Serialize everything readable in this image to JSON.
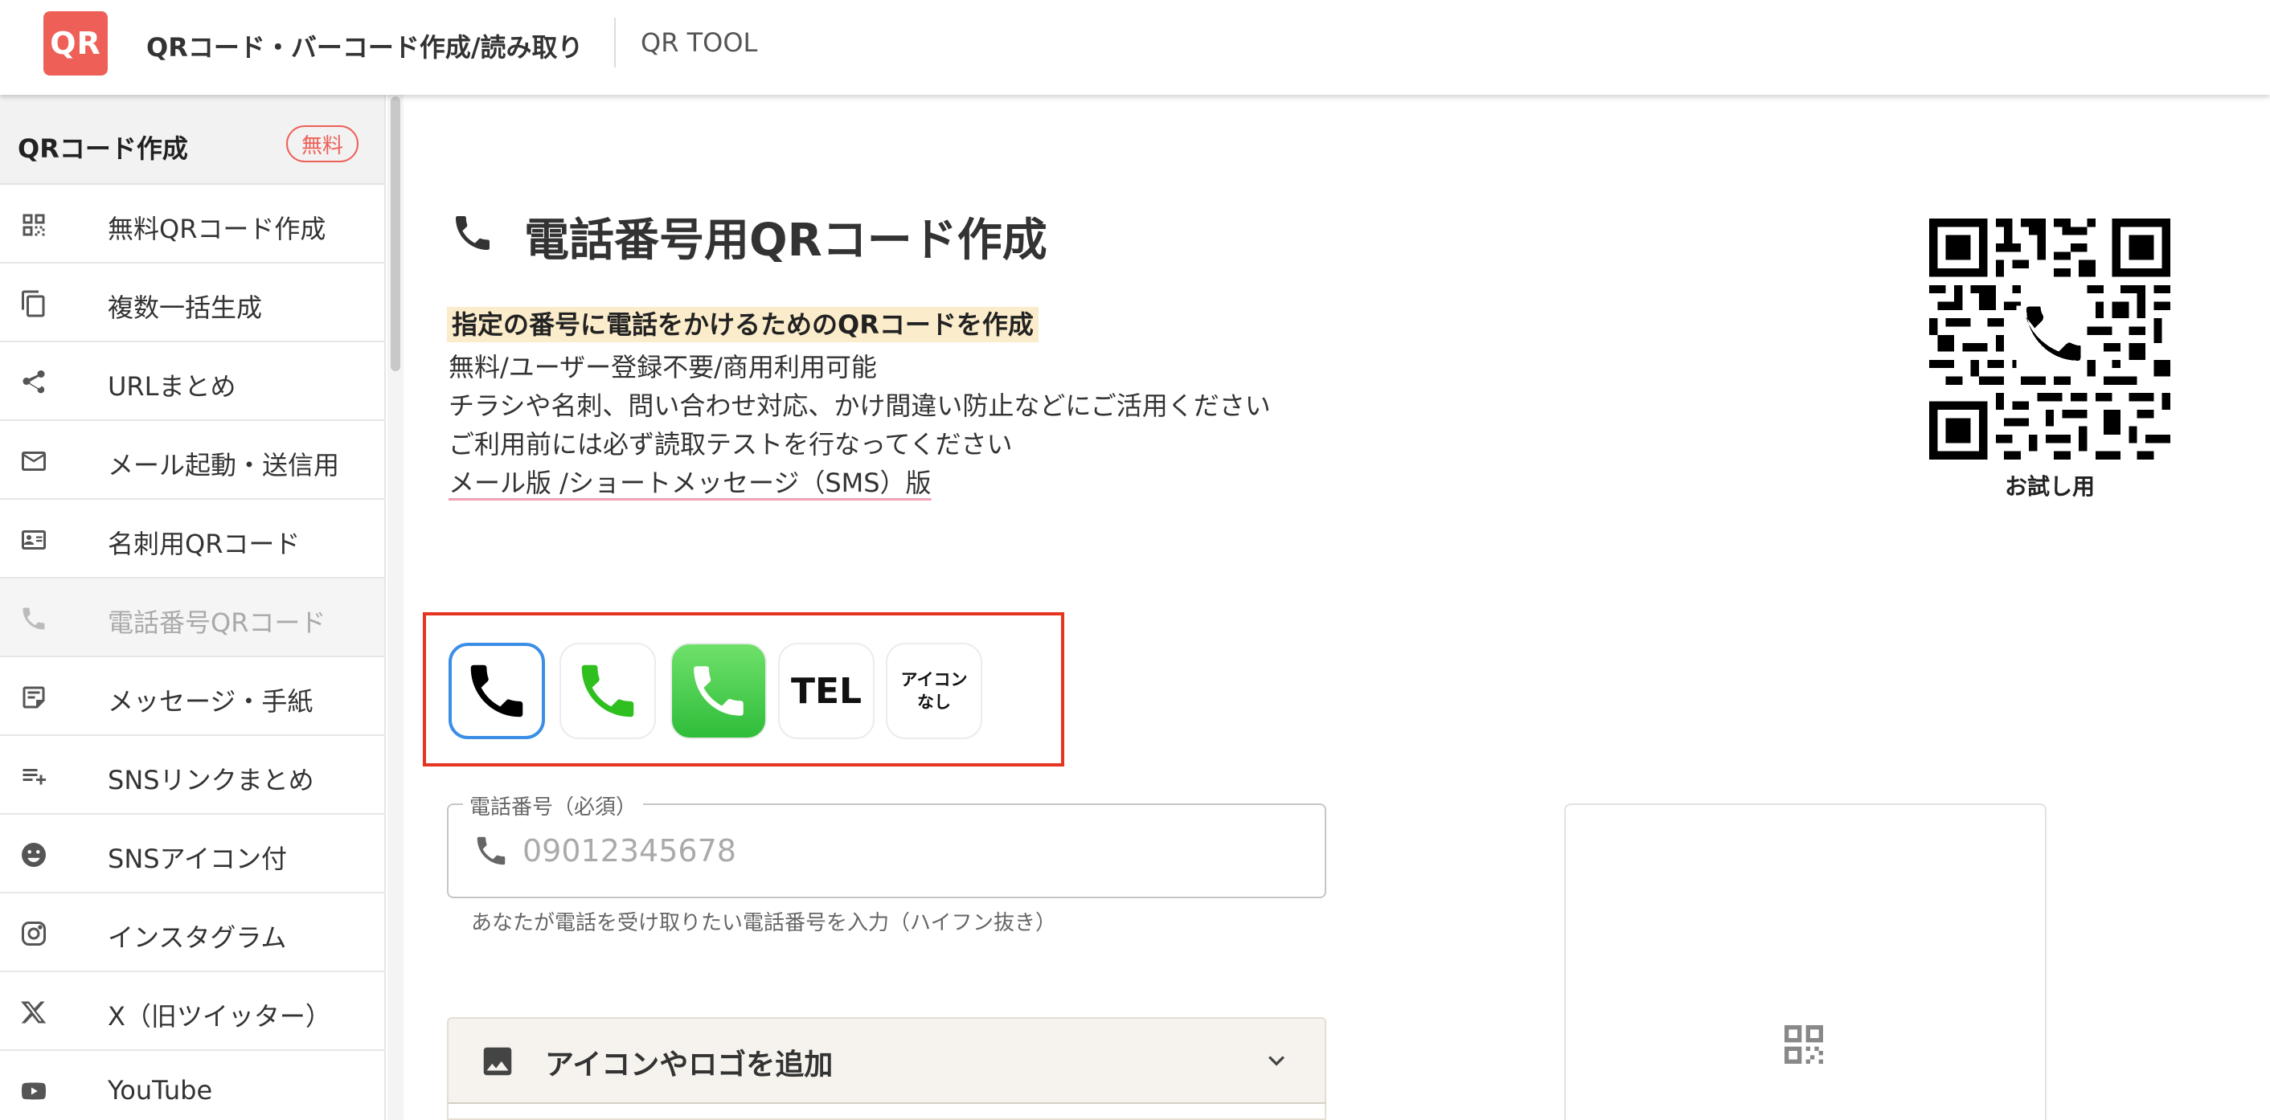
{
  "header": {
    "logo_text": "QR",
    "title": "QRコード・バーコード作成/読み取り",
    "sub": "QR TOOL",
    "accent": "#ee5f57"
  },
  "sidebar": {
    "heading": "QRコード作成",
    "badge": "無料",
    "items": [
      {
        "label": "無料QRコード作成",
        "icon": "qr-grid-icon"
      },
      {
        "label": "複数一括生成",
        "icon": "copy-icon"
      },
      {
        "label": "URLまとめ",
        "icon": "share-icon"
      },
      {
        "label": "メール起動・送信用",
        "icon": "mail-icon"
      },
      {
        "label": "名刺用QRコード",
        "icon": "id-card-icon"
      },
      {
        "label": "電話番号QRコード",
        "icon": "phone-icon",
        "active": true
      },
      {
        "label": "メッセージ・手紙",
        "icon": "note-icon"
      },
      {
        "label": "SNSリンクまとめ",
        "icon": "playlist-add-icon"
      },
      {
        "label": "SNSアイコン付",
        "icon": "smiley-icon"
      },
      {
        "label": "インスタグラム",
        "icon": "instagram-icon"
      },
      {
        "label": "X（旧ツイッター）",
        "icon": "x-logo-icon"
      },
      {
        "label": "YouTube",
        "icon": "youtube-icon"
      }
    ]
  },
  "main": {
    "title": "電話番号用QRコード作成",
    "highlight": "指定の番号に電話をかけるためのQRコードを作成",
    "lines": [
      "無料/ユーザー登録不要/商用利用可能",
      "チラシや名刺、問い合わせ対応、かけ間違い防止などにご活用ください",
      "ご利用前には必ず読取テストを行なってください"
    ],
    "link": "メール版 /ショートメッセージ（SMS）版",
    "sample_label": "お試し用",
    "icon_options": {
      "tel_label": "TEL",
      "none_label": "アイコン\nなし",
      "selected_index": 0,
      "selection_color": "#3a8ee6",
      "highlight_box_color": "#e53420"
    },
    "phone_field": {
      "legend": "電話番号（必須）",
      "placeholder": "09012345678",
      "value": "",
      "help": "あなたが電話を受け取りたい電話番号を入力（ハイフン抜き）"
    },
    "accordion": {
      "label": "アイコンやロゴを追加"
    }
  }
}
